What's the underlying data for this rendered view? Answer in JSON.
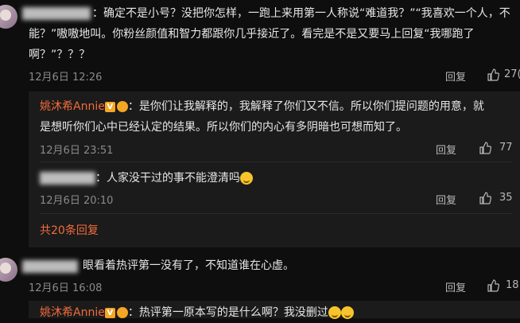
{
  "comments": [
    {
      "line1": "：确定不是小号？没把你怎样，一跑上来用第一人称说“难道我？”“我喜欢一个人，不",
      "line2": "能？”嗷嗷地叫。你粉丝颜值和智力都跟你几乎接近了。看完是不是又要马上回复“我哪跑了",
      "line3": "啊？”？？？",
      "time": "12月6日 12:26",
      "reply": "回复",
      "likes": "27("
    },
    {
      "text": "眼看着热评第一没有了，不知道谁在心虚。",
      "time": "12月6日 16:08",
      "reply": "回复",
      "likes": "18"
    }
  ],
  "replies": [
    {
      "author": "姚沐希Annie",
      "badge_v": "V",
      "line1": "：是你们让我解释的，我解释了你们又不信。所以你们提问题的用意，就",
      "line2": "是想听你们心中已经认定的结果。所以你们的内心有多阴暗也可想而知了。",
      "time": "12月6日 23:51",
      "reply": "回复",
      "likes": "77"
    },
    {
      "text": "：人家没干过的事不能澄清吗",
      "time": "12月6日 20:10",
      "reply": "回复",
      "likes": "35"
    },
    {
      "author": "姚沐希Annie",
      "badge_v": "V",
      "text": "：热评第一原本写的是什么啊？我没删过"
    }
  ],
  "more_replies": "共20条回复",
  "colors": {
    "author": "#f26b3a",
    "background": "#0e0e0e",
    "nested_bg": "#1b1b1b"
  }
}
